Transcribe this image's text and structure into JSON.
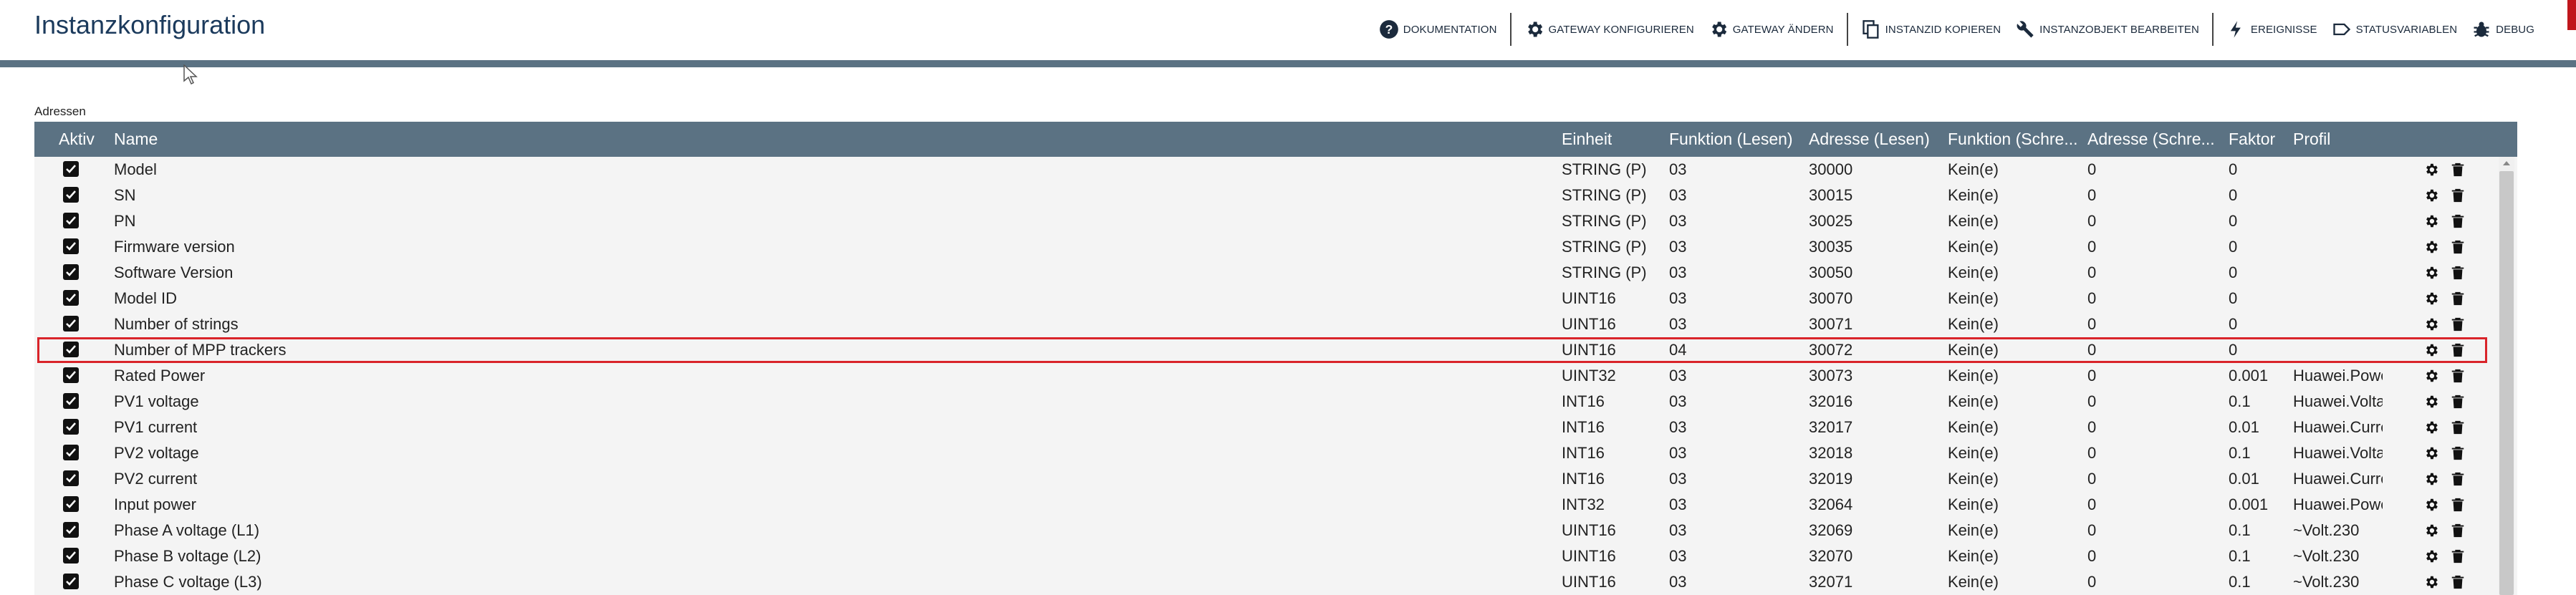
{
  "header": {
    "title": "Instanzkonfiguration",
    "toolbar": [
      {
        "label": "DOKUMENTATION",
        "icon": "help-circle-icon"
      },
      {
        "label": "GATEWAY KONFIGURIEREN",
        "icon": "gear-icon"
      },
      {
        "label": "GATEWAY ÄNDERN",
        "icon": "gear-icon"
      },
      {
        "label": "INSTANZID KOPIEREN",
        "icon": "copy-icon"
      },
      {
        "label": "INSTANZOBJEKT BEARBEITEN",
        "icon": "wrench-icon"
      },
      {
        "label": "EREIGNISSE",
        "icon": "lightning-icon"
      },
      {
        "label": "STATUSVARIABLEN",
        "icon": "tag-icon"
      },
      {
        "label": "DEBUG",
        "icon": "bug-icon"
      }
    ]
  },
  "section": {
    "label": "Adressen"
  },
  "table": {
    "columns": [
      "Aktiv",
      "Name",
      "Einheit",
      "Funktion (Lesen)",
      "Adresse (Lesen)",
      "Funktion (Schre...",
      "Adresse (Schre...",
      "Faktor",
      "Profil"
    ],
    "rows": [
      {
        "name": "Model",
        "unit": "STRING (P)",
        "fr": "03",
        "ar": "30000",
        "fs": "Kein(e)",
        "as": "0",
        "factor": "0",
        "profile": ""
      },
      {
        "name": "SN",
        "unit": "STRING (P)",
        "fr": "03",
        "ar": "30015",
        "fs": "Kein(e)",
        "as": "0",
        "factor": "0",
        "profile": ""
      },
      {
        "name": "PN",
        "unit": "STRING (P)",
        "fr": "03",
        "ar": "30025",
        "fs": "Kein(e)",
        "as": "0",
        "factor": "0",
        "profile": ""
      },
      {
        "name": "Firmware version",
        "unit": "STRING (P)",
        "fr": "03",
        "ar": "30035",
        "fs": "Kein(e)",
        "as": "0",
        "factor": "0",
        "profile": ""
      },
      {
        "name": "Software Version",
        "unit": "STRING (P)",
        "fr": "03",
        "ar": "30050",
        "fs": "Kein(e)",
        "as": "0",
        "factor": "0",
        "profile": ""
      },
      {
        "name": "Model ID",
        "unit": "UINT16",
        "fr": "03",
        "ar": "30070",
        "fs": "Kein(e)",
        "as": "0",
        "factor": "0",
        "profile": ""
      },
      {
        "name": "Number of strings",
        "unit": "UINT16",
        "fr": "03",
        "ar": "30071",
        "fs": "Kein(e)",
        "as": "0",
        "factor": "0",
        "profile": ""
      },
      {
        "name": "Number of MPP trackers",
        "unit": "UINT16",
        "fr": "04",
        "ar": "30072",
        "fs": "Kein(e)",
        "as": "0",
        "factor": "0",
        "profile": ""
      },
      {
        "name": "Rated Power",
        "unit": "UINT32",
        "fr": "03",
        "ar": "30073",
        "fs": "Kein(e)",
        "as": "0",
        "factor": "0.001",
        "profile": "Huawei.Powe..."
      },
      {
        "name": "PV1 voltage",
        "unit": "INT16",
        "fr": "03",
        "ar": "32016",
        "fs": "Kein(e)",
        "as": "0",
        "factor": "0.1",
        "profile": "Huawei.Voltage"
      },
      {
        "name": "PV1 current",
        "unit": "INT16",
        "fr": "03",
        "ar": "32017",
        "fs": "Kein(e)",
        "as": "0",
        "factor": "0.01",
        "profile": "Huawei.Current"
      },
      {
        "name": "PV2 voltage",
        "unit": "INT16",
        "fr": "03",
        "ar": "32018",
        "fs": "Kein(e)",
        "as": "0",
        "factor": "0.1",
        "profile": "Huawei.Voltage"
      },
      {
        "name": "PV2 current",
        "unit": "INT16",
        "fr": "03",
        "ar": "32019",
        "fs": "Kein(e)",
        "as": "0",
        "factor": "0.01",
        "profile": "Huawei.Current"
      },
      {
        "name": "Input power",
        "unit": "INT32",
        "fr": "03",
        "ar": "32064",
        "fs": "Kein(e)",
        "as": "0",
        "factor": "0.001",
        "profile": "Huawei.Powe..."
      },
      {
        "name": "Phase A voltage (L1)",
        "unit": "UINT16",
        "fr": "03",
        "ar": "32069",
        "fs": "Kein(e)",
        "as": "0",
        "factor": "0.1",
        "profile": "~Volt.230"
      },
      {
        "name": "Phase B voltage (L2)",
        "unit": "UINT16",
        "fr": "03",
        "ar": "32070",
        "fs": "Kein(e)",
        "as": "0",
        "factor": "0.1",
        "profile": "~Volt.230"
      },
      {
        "name": "Phase C voltage (L3)",
        "unit": "UINT16",
        "fr": "03",
        "ar": "32071",
        "fs": "Kein(e)",
        "as": "0",
        "factor": "0.1",
        "profile": "~Volt.230"
      }
    ]
  },
  "colors": {
    "accent": "#5b7283",
    "highlight": "#d9242a",
    "title": "#1b3a5c"
  }
}
